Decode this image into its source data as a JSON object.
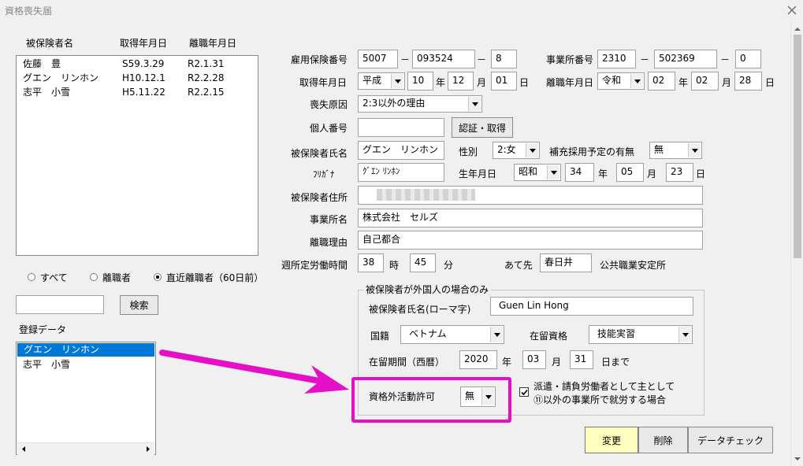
{
  "window": {
    "title": "資格喪失届"
  },
  "list_panel": {
    "headers": {
      "name": "被保険者名",
      "acquired": "取得年月日",
      "left": "離職年月日"
    },
    "rows": [
      {
        "name": "佐藤　豊",
        "acquired": "S59.3.29",
        "left": "R2.1.31"
      },
      {
        "name": "グエン　リンホン",
        "acquired": "H10.12.1",
        "left": "R2.2.28"
      },
      {
        "name": "志平　小雪",
        "acquired": "H5.11.22",
        "left": "R2.2.15"
      }
    ]
  },
  "filter": {
    "all": "すべて",
    "separated": "離職者",
    "recent": "直近離職者（60日前）"
  },
  "search": {
    "value": "",
    "button": "検索"
  },
  "registered": {
    "title": "登録データ",
    "items": [
      "グエン　リンホン",
      "志平　小雪"
    ]
  },
  "form": {
    "insurance_no": {
      "label": "雇用保険番号",
      "p1": "5007",
      "p2": "093524",
      "p3": "8"
    },
    "office_no": {
      "label": "事業所番号",
      "p1": "2310",
      "p2": "502369",
      "p3": "0"
    },
    "dash": "－",
    "acquired_date": {
      "label": "取得年月日",
      "era": "平成",
      "year": "10",
      "month": "12",
      "day": "01"
    },
    "separation_date": {
      "label": "離職年月日",
      "era": "令和",
      "year": "02",
      "month": "02",
      "day": "28"
    },
    "units": {
      "year": "年",
      "month": "月",
      "day": "日"
    },
    "reason": {
      "label": "喪失原因",
      "value": "2:3以外の理由"
    },
    "my_number": {
      "label": "個人番号",
      "value": "",
      "button": "認証・取得"
    },
    "insured_name": {
      "label": "被保険者氏名",
      "value": "グエン　リンホン"
    },
    "gender": {
      "label": "性別",
      "value": "2:女"
    },
    "replacement": {
      "label": "補充採用予定の有無",
      "value": "無"
    },
    "furigana": {
      "label": "ﾌﾘｶﾞﾅ",
      "value": "ｸﾞｴﾝ ﾘﾝﾎﾝ"
    },
    "birth": {
      "label": "生年月日",
      "era": "昭和",
      "year": "34",
      "month": "05",
      "day": "23"
    },
    "address": {
      "label": "被保険者住所",
      "value": ""
    },
    "office_name": {
      "label": "事業所名",
      "value": "株式会社　セルズ"
    },
    "separation_reason": {
      "label": "離職理由",
      "value": "自己都合"
    },
    "weekly_hours": {
      "label": "週所定労働時間",
      "hours": "38",
      "h_unit": "時",
      "minutes": "45",
      "m_unit": "分"
    },
    "destination": {
      "label": "あて先",
      "value": "春日井",
      "suffix": "公共職業安定所"
    }
  },
  "foreigner": {
    "title": "被保険者が外国人の場合のみ",
    "roman_name": {
      "label": "被保険者氏名(ローマ字)",
      "value": "Guen Lin Hong"
    },
    "nationality": {
      "label": "国籍",
      "value": "ベトナム"
    },
    "status": {
      "label": "在留資格",
      "value": "技能実習"
    },
    "period": {
      "label": "在留期間（西暦）",
      "year": "2020",
      "month": "03",
      "day": "31",
      "until": "日まで"
    },
    "permission": {
      "label": "資格外活動許可",
      "value": "無"
    },
    "dispatch": {
      "line1": "派遣・請負労働者として主として",
      "line2": "⑪以外の事業所で就労する場合",
      "checked": true
    }
  },
  "actions": {
    "change": "変更",
    "delete": "削除",
    "check": "データチェック"
  },
  "colors": {
    "highlight": "#e60fc8",
    "selection": "#0078d7",
    "change_button": "#ffffc0"
  }
}
